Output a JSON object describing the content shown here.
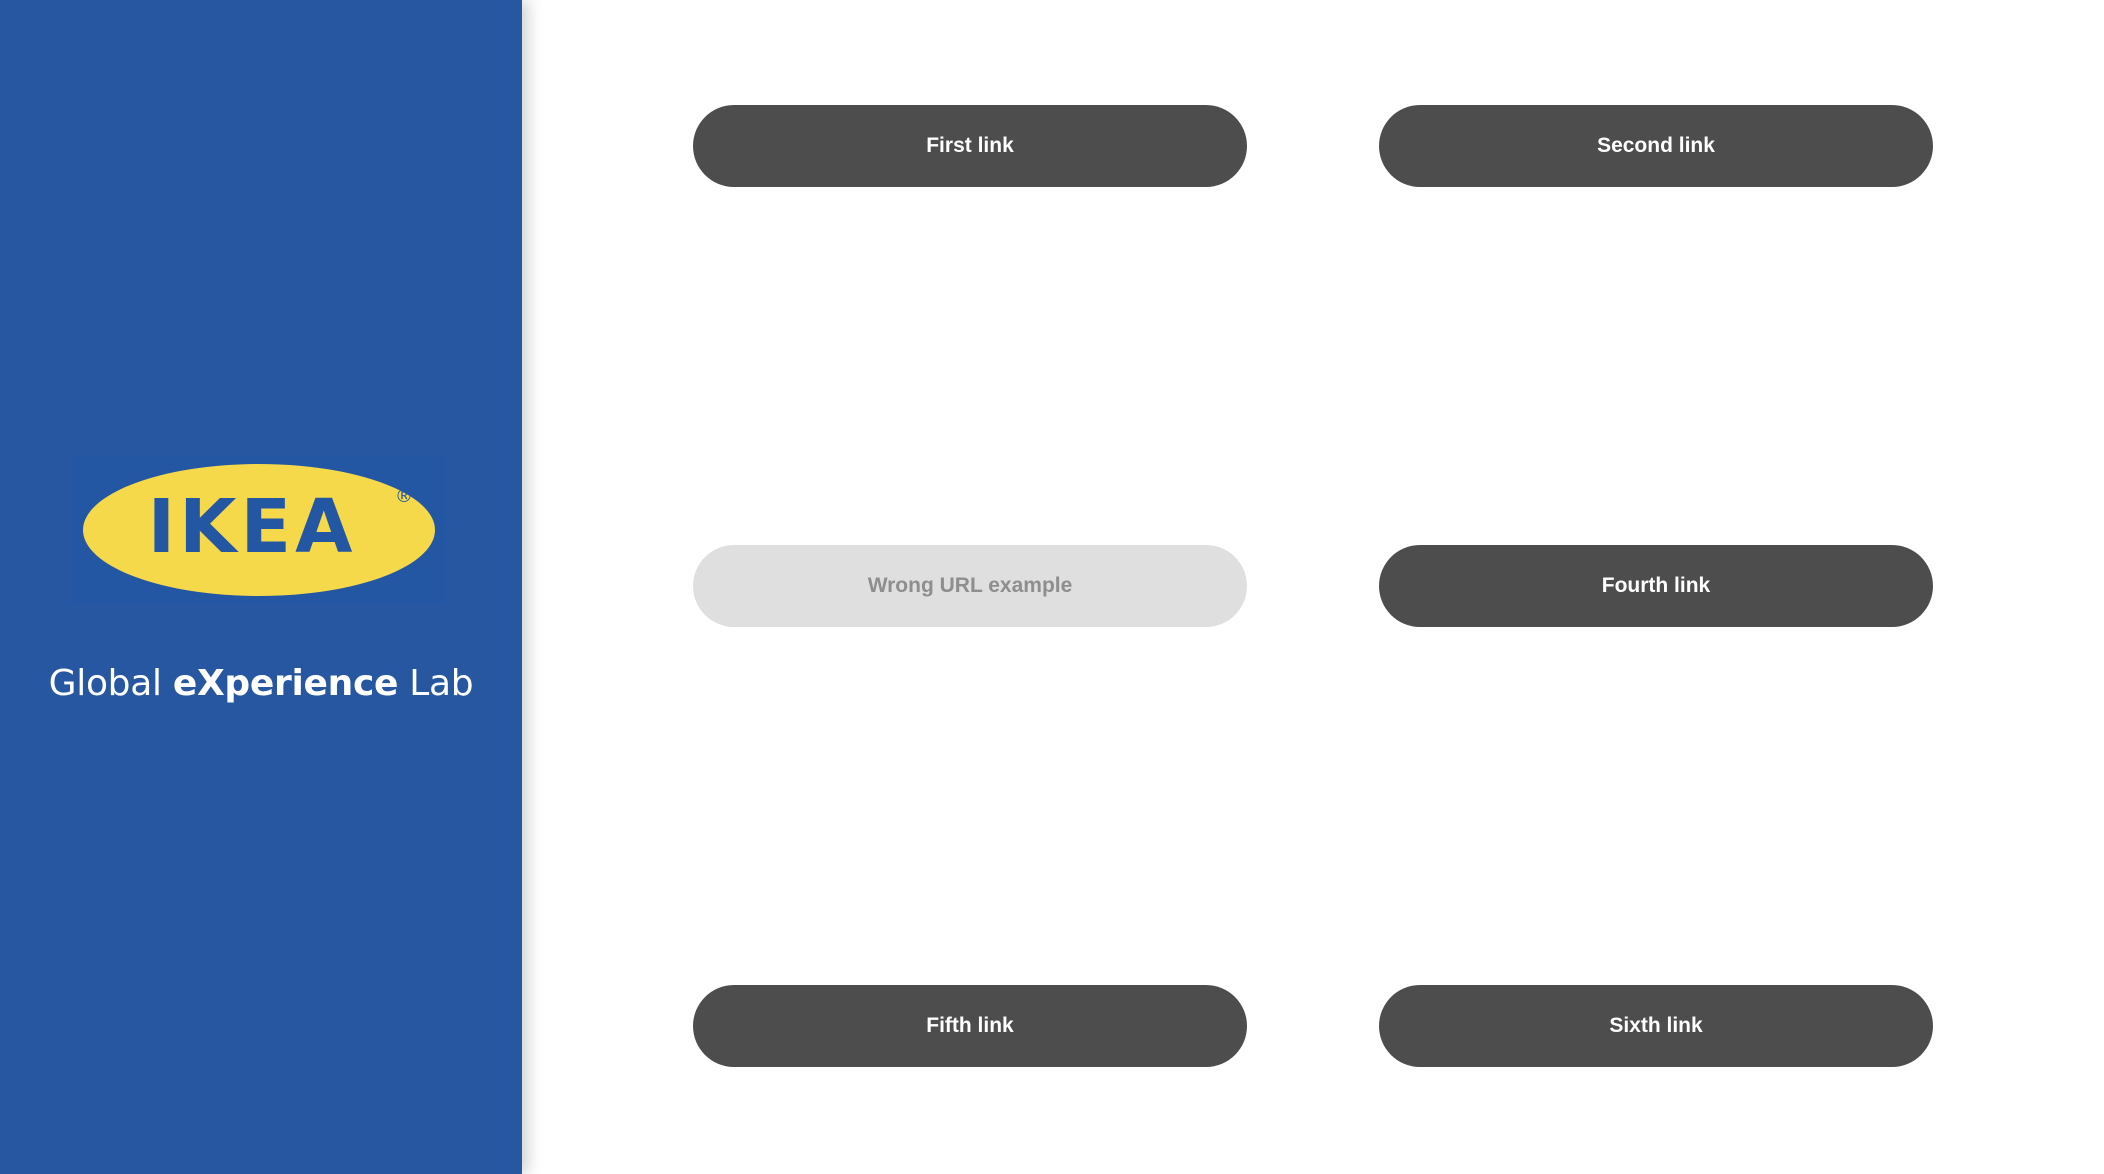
{
  "sidebar": {
    "logo": {
      "text": "IKEA",
      "mark": "®",
      "colors": {
        "oval": "#f5d94a",
        "text": "#2457a3",
        "background": "#2457a3"
      }
    },
    "lab_title": {
      "part1": "Global ",
      "part2": "eXperience",
      "part3": " Lab"
    },
    "background_color": "#2657a0"
  },
  "links": [
    {
      "label": "First link",
      "state": "active"
    },
    {
      "label": "Second link",
      "state": "active"
    },
    {
      "label": "Wrong URL example",
      "state": "disabled"
    },
    {
      "label": "Fourth link",
      "state": "active"
    },
    {
      "label": "Fifth link",
      "state": "active"
    },
    {
      "label": "Sixth link",
      "state": "active"
    }
  ],
  "colors": {
    "button_active": "#4d4d4d",
    "button_active_text": "#ffffff",
    "button_disabled": "#dfdfdf",
    "button_disabled_text": "#8e8e8e"
  }
}
